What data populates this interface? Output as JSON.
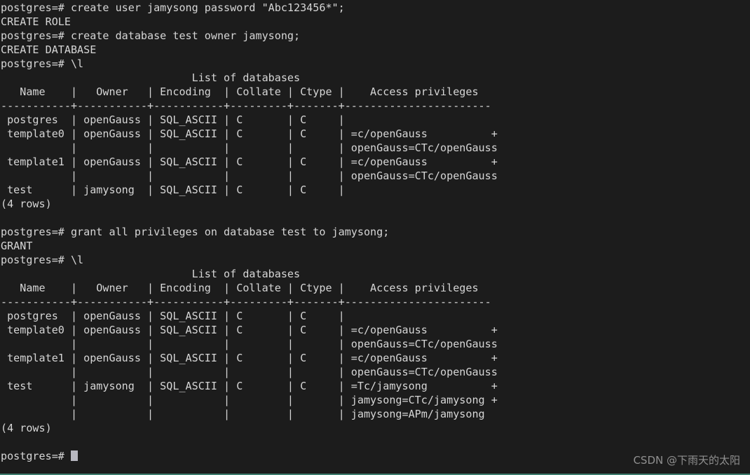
{
  "terminal": {
    "background_color": "#1c1c1c",
    "foreground_color": "#d6d6d6",
    "bottom_border_color": "#3e7d6e",
    "cursor_color": "#b8b8c0",
    "prompt": "postgres=# ",
    "lines": [
      "postgres=# create user jamysong password \"Abc123456*\";",
      "CREATE ROLE",
      "postgres=# create database test owner jamysong;",
      "CREATE DATABASE",
      "postgres=# \\l",
      "                              List of databases",
      "   Name    |   Owner   | Encoding  | Collate | Ctype |    Access privileges",
      "-----------+-----------+-----------+---------+-------+-----------------------",
      " postgres  | openGauss | SQL_ASCII | C       | C     |",
      " template0 | openGauss | SQL_ASCII | C       | C     | =c/openGauss          +",
      "           |           |           |         |       | openGauss=CTc/openGauss",
      " template1 | openGauss | SQL_ASCII | C       | C     | =c/openGauss          +",
      "           |           |           |         |       | openGauss=CTc/openGauss",
      " test      | jamysong  | SQL_ASCII | C       | C     |",
      "(4 rows)",
      "",
      "postgres=# grant all privileges on database test to jamysong;",
      "GRANT",
      "postgres=# \\l",
      "                              List of databases",
      "   Name    |   Owner   | Encoding  | Collate | Ctype |    Access privileges",
      "-----------+-----------+-----------+---------+-------+-----------------------",
      " postgres  | openGauss | SQL_ASCII | C       | C     |",
      " template0 | openGauss | SQL_ASCII | C       | C     | =c/openGauss          +",
      "           |           |           |         |       | openGauss=CTc/openGauss",
      " template1 | openGauss | SQL_ASCII | C       | C     | =c/openGauss          +",
      "           |           |           |         |       | openGauss=CTc/openGauss",
      " test      | jamysong  | SQL_ASCII | C       | C     | =Tc/jamysong          +",
      "           |           |           |         |       | jamysong=CTc/jamysong +",
      "           |           |           |         |       | jamysong=APm/jamysong",
      "(4 rows)",
      ""
    ],
    "final_prompt": "postgres=# ",
    "session": {
      "commands": [
        "create user jamysong password \"Abc123456*\";",
        "create database test owner jamysong;",
        "\\l",
        "grant all privileges on database test to jamysong;",
        "\\l"
      ],
      "responses": [
        "CREATE ROLE",
        "CREATE DATABASE",
        "GRANT"
      ],
      "row_count_label": "(4 rows)"
    },
    "tables": [
      {
        "title": "List of databases",
        "columns": [
          "Name",
          "Owner",
          "Encoding",
          "Collate",
          "Ctype",
          "Access privileges"
        ],
        "rows": [
          {
            "name": "postgres",
            "owner": "openGauss",
            "encoding": "SQL_ASCII",
            "collate": "C",
            "ctype": "C",
            "access_privileges": []
          },
          {
            "name": "template0",
            "owner": "openGauss",
            "encoding": "SQL_ASCII",
            "collate": "C",
            "ctype": "C",
            "access_privileges": [
              "=c/openGauss",
              "openGauss=CTc/openGauss"
            ]
          },
          {
            "name": "template1",
            "owner": "openGauss",
            "encoding": "SQL_ASCII",
            "collate": "C",
            "ctype": "C",
            "access_privileges": [
              "=c/openGauss",
              "openGauss=CTc/openGauss"
            ]
          },
          {
            "name": "test",
            "owner": "jamysong",
            "encoding": "SQL_ASCII",
            "collate": "C",
            "ctype": "C",
            "access_privileges": []
          }
        ],
        "footer": "(4 rows)"
      },
      {
        "title": "List of databases",
        "columns": [
          "Name",
          "Owner",
          "Encoding",
          "Collate",
          "Ctype",
          "Access privileges"
        ],
        "rows": [
          {
            "name": "postgres",
            "owner": "openGauss",
            "encoding": "SQL_ASCII",
            "collate": "C",
            "ctype": "C",
            "access_privileges": []
          },
          {
            "name": "template0",
            "owner": "openGauss",
            "encoding": "SQL_ASCII",
            "collate": "C",
            "ctype": "C",
            "access_privileges": [
              "=c/openGauss",
              "openGauss=CTc/openGauss"
            ]
          },
          {
            "name": "template1",
            "owner": "openGauss",
            "encoding": "SQL_ASCII",
            "collate": "C",
            "ctype": "C",
            "access_privileges": [
              "=c/openGauss",
              "openGauss=CTc/openGauss"
            ]
          },
          {
            "name": "test",
            "owner": "jamysong",
            "encoding": "SQL_ASCII",
            "collate": "C",
            "ctype": "C",
            "access_privileges": [
              "=Tc/jamysong",
              "jamysong=CTc/jamysong",
              "jamysong=APm/jamysong"
            ]
          }
        ],
        "footer": "(4 rows)"
      }
    ]
  },
  "watermark": {
    "text": "CSDN @下雨天的太阳"
  }
}
